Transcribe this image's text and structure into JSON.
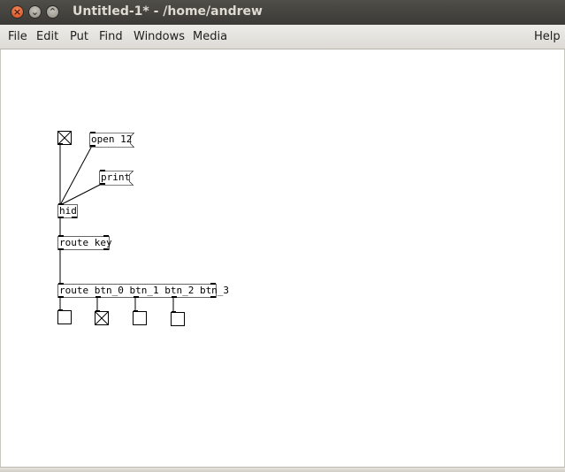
{
  "window": {
    "title": "Untitled-1* - /home/andrew",
    "close_glyph": "×",
    "min_glyph": "⌄",
    "max_glyph": "⌃"
  },
  "menubar": {
    "items": [
      "File",
      "Edit",
      "Put",
      "Find",
      "Windows",
      "Media"
    ],
    "help": "Help"
  },
  "patch": {
    "objects": {
      "open_msg": "open 12",
      "print_msg": "print",
      "hid": "hid",
      "route_key": "route key",
      "route_btns": "route btn_0 btn_1 btn_2 btn_3"
    },
    "toggles": {
      "top": true,
      "btn_0": false,
      "btn_1": true,
      "btn_2": false,
      "btn_3": false
    }
  }
}
